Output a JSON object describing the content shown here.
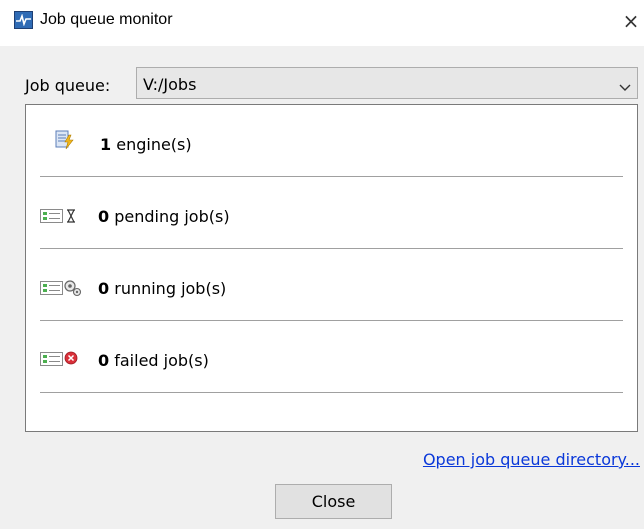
{
  "window": {
    "title": "Job queue monitor",
    "close_glyph": "×",
    "app_icon": "monitor-icon"
  },
  "queue": {
    "label": "Job queue:",
    "selected": "V:/Jobs"
  },
  "stats": [
    {
      "count": "1",
      "label": "engine(s)",
      "icon": "engine-icon"
    },
    {
      "count": "0",
      "label": "pending job(s)",
      "icon": "pending-job-icon"
    },
    {
      "count": "0",
      "label": "running job(s)",
      "icon": "running-job-icon"
    },
    {
      "count": "0",
      "label": "failed job(s)",
      "icon": "failed-job-icon"
    }
  ],
  "actions": {
    "open_dir_link": "Open job queue directory...",
    "close_button": "Close"
  },
  "colors": {
    "link": "#0a38d9",
    "failed_accent": "#d9303a"
  }
}
